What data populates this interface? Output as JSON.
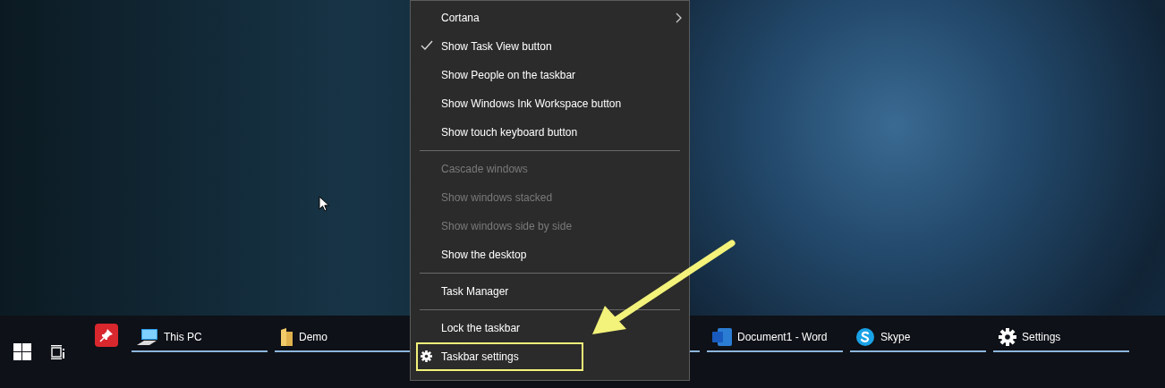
{
  "context_menu": {
    "items": [
      {
        "kind": "item",
        "label": "Cortana",
        "checked": false,
        "disabled": false,
        "submenu": true,
        "highlighted": false
      },
      {
        "kind": "item",
        "label": "Show Task View button",
        "checked": true,
        "disabled": false,
        "submenu": false,
        "highlighted": false
      },
      {
        "kind": "item",
        "label": "Show People on the taskbar",
        "checked": false,
        "disabled": false,
        "submenu": false,
        "highlighted": false
      },
      {
        "kind": "item",
        "label": "Show Windows Ink Workspace button",
        "checked": false,
        "disabled": false,
        "submenu": false,
        "highlighted": false
      },
      {
        "kind": "item",
        "label": "Show touch keyboard button",
        "checked": false,
        "disabled": false,
        "submenu": false,
        "highlighted": false
      },
      {
        "kind": "separator"
      },
      {
        "kind": "item",
        "label": "Cascade windows",
        "checked": false,
        "disabled": true,
        "submenu": false,
        "highlighted": false
      },
      {
        "kind": "item",
        "label": "Show windows stacked",
        "checked": false,
        "disabled": true,
        "submenu": false,
        "highlighted": false
      },
      {
        "kind": "item",
        "label": "Show windows side by side",
        "checked": false,
        "disabled": true,
        "submenu": false,
        "highlighted": false
      },
      {
        "kind": "item",
        "label": "Show the desktop",
        "checked": false,
        "disabled": false,
        "submenu": false,
        "highlighted": false
      },
      {
        "kind": "separator"
      },
      {
        "kind": "item",
        "label": "Task Manager",
        "checked": false,
        "disabled": false,
        "submenu": false,
        "highlighted": false
      },
      {
        "kind": "separator"
      },
      {
        "kind": "item",
        "label": "Lock the taskbar",
        "checked": false,
        "disabled": false,
        "submenu": false,
        "highlighted": false
      },
      {
        "kind": "settings",
        "label": "Taskbar settings",
        "checked": false,
        "disabled": false,
        "submenu": false,
        "highlighted": true
      }
    ]
  },
  "taskbar": {
    "tasks": [
      {
        "kind": "computer",
        "label": "This PC"
      },
      {
        "kind": "folder",
        "label": "Demo"
      },
      {
        "kind": "hidden"
      },
      {
        "kind": "word",
        "label": "Document1 - Word"
      },
      {
        "kind": "skype",
        "label": "Skype"
      },
      {
        "kind": "settings",
        "label": "Settings"
      }
    ]
  }
}
